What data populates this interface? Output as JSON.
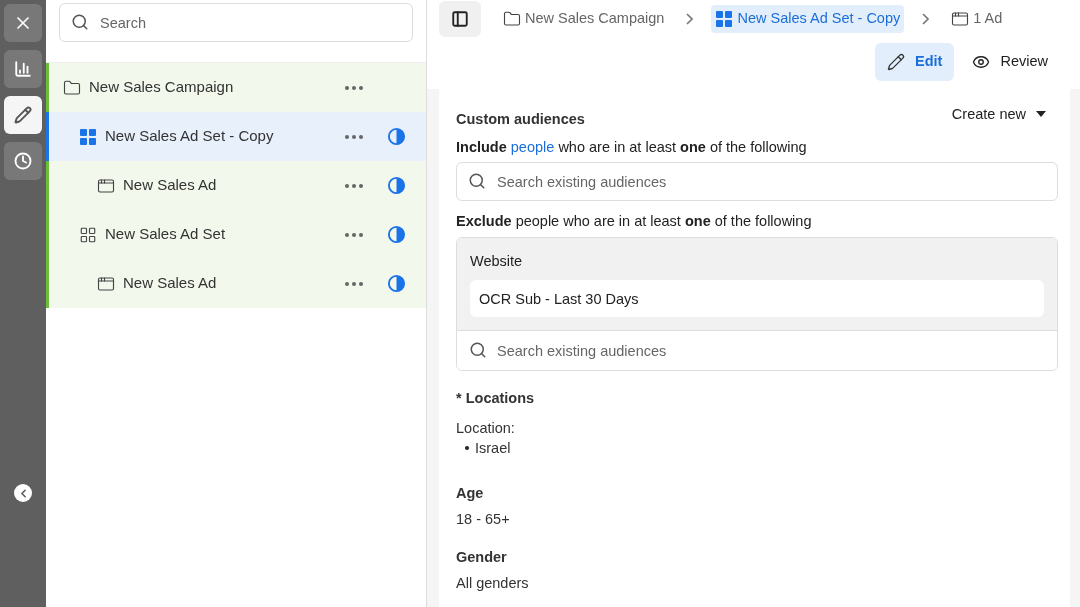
{
  "rail": {
    "items": [
      {
        "kind": "chart",
        "selected": false
      },
      {
        "kind": "edit",
        "selected": true
      },
      {
        "kind": "history",
        "selected": false
      }
    ]
  },
  "tree": {
    "search": {
      "placeholder": "Search"
    },
    "items": [
      {
        "kind": "campaign",
        "label": "New Sales Campaign",
        "selected": false,
        "children": [
          {
            "kind": "adset",
            "label": "New Sales Ad Set - Copy",
            "selected": true,
            "children": [
              {
                "kind": "ad",
                "label": "New Sales Ad",
                "selected": false
              }
            ]
          },
          {
            "kind": "adset",
            "label": "New Sales Ad Set",
            "selected": false,
            "children": [
              {
                "kind": "ad",
                "label": "New Sales Ad",
                "selected": false
              }
            ]
          }
        ]
      }
    ]
  },
  "breadcrumbs": [
    {
      "kind": "campaign",
      "label": "New Sales Campaign",
      "selected": false
    },
    {
      "kind": "adset",
      "label": "New Sales Ad Set - Copy",
      "selected": true
    },
    {
      "kind": "ad",
      "label": "1 Ad",
      "selected": false
    }
  ],
  "modes": [
    {
      "kind": "edit",
      "label": "Edit",
      "selected": true
    },
    {
      "kind": "review",
      "label": "Review",
      "selected": false
    }
  ],
  "custom_audiences": {
    "title": "Custom audiences",
    "create_new": "Create new",
    "include": {
      "before": "**Include**",
      "link": "people",
      "after": "who are in at least **one** of the following"
    },
    "include_search": {
      "placeholder": "Search existing audiences"
    },
    "exclude": "**Exclude** people who are in at least **one** of the following",
    "excluded_group": {
      "title": "Website",
      "items": [
        "OCR Sub - Last 30 Days"
      ]
    },
    "exclude_search": {
      "placeholder": "Search existing audiences"
    }
  },
  "locations": {
    "title": "* Locations",
    "label": "Location:",
    "items": [
      "Israel"
    ]
  },
  "age": {
    "title": "Age",
    "value": "18 - 65+"
  },
  "gender": {
    "title": "Gender",
    "value": "All genders"
  }
}
